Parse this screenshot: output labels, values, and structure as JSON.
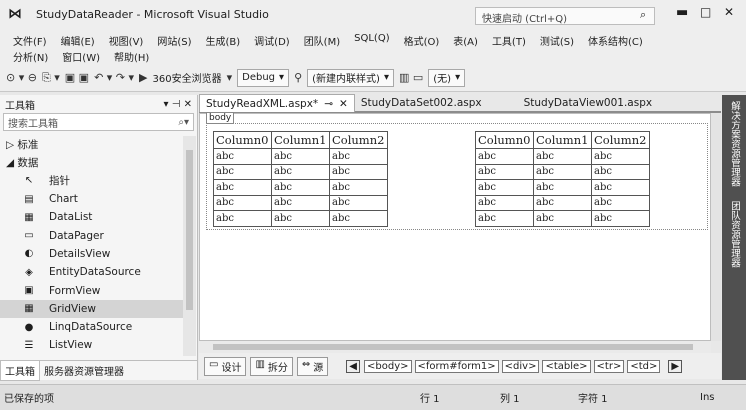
{
  "title": "StudyDataReader - Microsoft Visual Studio",
  "quick_launch": "快速启动 (Ctrl+Q)",
  "menu": {
    "row1": [
      "文件(F)",
      "编辑(E)",
      "视图(V)",
      "网站(S)",
      "生成(B)",
      "调试(D)",
      "团队(M)",
      "SQL(Q)",
      "格式(O)",
      "表(A)",
      "工具(T)",
      "测试(S)",
      "体系结构(C)"
    ],
    "row2": [
      "分析(N)",
      "窗口(W)",
      "帮助(H)"
    ]
  },
  "toolbar": {
    "browser": "360安全浏览器",
    "config": "Debug",
    "style": "(新建内联样式)",
    "target": "(无)"
  },
  "toolbox": {
    "title": "工具箱",
    "search": "搜索工具箱",
    "cat1": "▷ 标准",
    "cat2": "◢ 数据",
    "items": [
      {
        "label": "指针",
        "icon": "↖"
      },
      {
        "label": "Chart",
        "icon": "▤"
      },
      {
        "label": "DataList",
        "icon": "▦"
      },
      {
        "label": "DataPager",
        "icon": "▭"
      },
      {
        "label": "DetailsView",
        "icon": "◐"
      },
      {
        "label": "EntityDataSource",
        "icon": "◈"
      },
      {
        "label": "FormView",
        "icon": "▣"
      },
      {
        "label": "GridView",
        "icon": "▦"
      },
      {
        "label": "LinqDataSource",
        "icon": "●"
      },
      {
        "label": "ListView",
        "icon": "☰"
      }
    ],
    "tabs": [
      "工具箱",
      "服务器资源管理器"
    ]
  },
  "doc_tabs": [
    {
      "label": "StudyReadXML.aspx*",
      "active": true
    },
    {
      "label": "StudyDataSet002.aspx"
    },
    {
      "label": "StudyDataView001.aspx"
    }
  ],
  "body_tag": "body",
  "grid": {
    "columns": [
      "Column0",
      "Column1",
      "Column2"
    ],
    "rows": [
      [
        "abc",
        "abc",
        "abc"
      ],
      [
        "abc",
        "abc",
        "abc"
      ],
      [
        "abc",
        "abc",
        "abc"
      ],
      [
        "abc",
        "abc",
        "abc"
      ],
      [
        "abc",
        "abc",
        "abc"
      ]
    ]
  },
  "view_buttons": [
    "设计",
    "拆分",
    "源"
  ],
  "breadcrumbs": [
    "<body>",
    "<form#form1>",
    "<div>",
    "<table>",
    "<tr>",
    "<td>"
  ],
  "side_panels": [
    "解决方案资源管理器",
    "团队资源管理器"
  ],
  "status": {
    "text": "已保存的项",
    "line": "行 1",
    "col": "列 1",
    "char": "字符 1",
    "mode": "Ins"
  }
}
